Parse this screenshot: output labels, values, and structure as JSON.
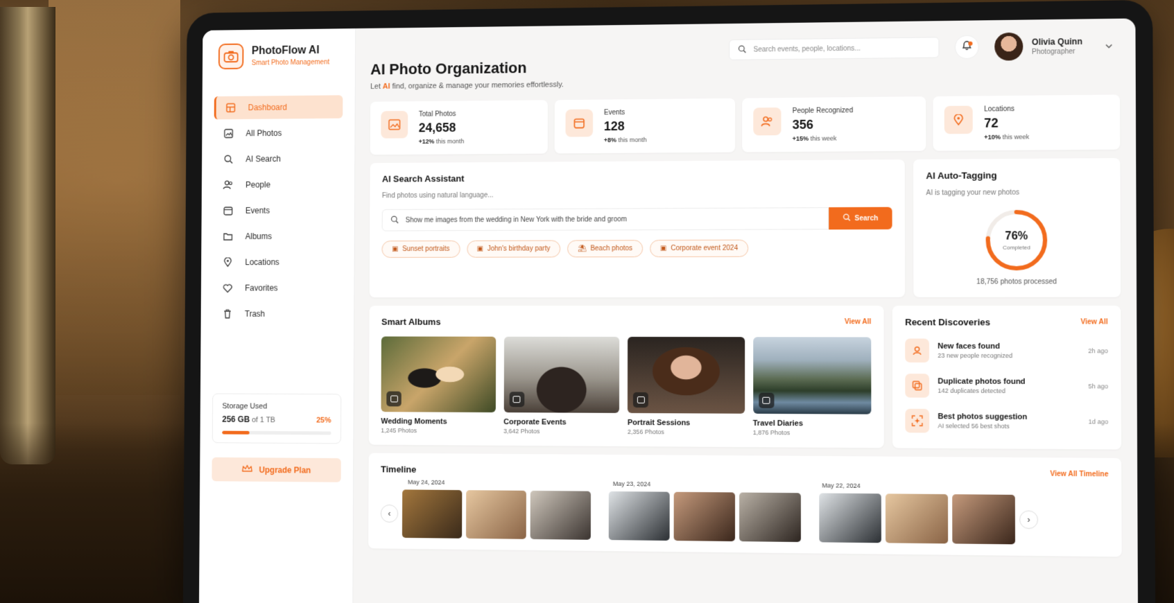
{
  "brand": {
    "name": "PhotoFlow AI",
    "tagline": "Smart Photo Management"
  },
  "sidebar": {
    "items": [
      {
        "label": "Dashboard",
        "icon": "dashboard-icon",
        "active": true
      },
      {
        "label": "All Photos",
        "icon": "photos-icon"
      },
      {
        "label": "AI Search",
        "icon": "search-icon"
      },
      {
        "label": "People",
        "icon": "people-icon"
      },
      {
        "label": "Events",
        "icon": "calendar-icon"
      },
      {
        "label": "Albums",
        "icon": "folder-icon"
      },
      {
        "label": "Locations",
        "icon": "location-pin-icon"
      },
      {
        "label": "Favorites",
        "icon": "heart-icon"
      },
      {
        "label": "Trash",
        "icon": "trash-icon"
      }
    ],
    "storage": {
      "title": "Storage Used",
      "used": "256 GB",
      "total": "of 1 TB",
      "percent_label": "25%",
      "percent": 25
    },
    "upgrade_label": "Upgrade Plan"
  },
  "topbar": {
    "search_placeholder": "Search events, people, locations...",
    "user": {
      "name": "Olivia Quinn",
      "role": "Photographer"
    }
  },
  "page": {
    "title": "AI Photo Organization",
    "subtitle_prefix": "Let ",
    "subtitle_highlight": "AI",
    "subtitle_suffix": " find, organize & manage your memories effortlessly."
  },
  "stats": [
    {
      "label": "Total Photos",
      "value": "24,658",
      "delta": "+12%",
      "delta_text": "this month",
      "icon": "image-icon"
    },
    {
      "label": "Events",
      "value": "128",
      "delta": "+8%",
      "delta_text": "this month",
      "icon": "calendar-icon"
    },
    {
      "label": "People Recognized",
      "value": "356",
      "delta": "+15%",
      "delta_text": "this week",
      "icon": "people-icon"
    },
    {
      "label": "Locations",
      "value": "72",
      "delta": "+10%",
      "delta_text": "this week",
      "icon": "location-pin-icon"
    }
  ],
  "assistant": {
    "title": "AI Search Assistant",
    "subtitle": "Find photos using natural language...",
    "query": "Show me images from the wedding in New York with the bride and groom",
    "button": "Search",
    "chips": [
      "Sunset portraits",
      "John's birthday party",
      "Beach photos",
      "Corporate event 2024"
    ]
  },
  "tagging": {
    "title": "AI Auto-Tagging",
    "subtitle": "AI is tagging your new photos",
    "percent_label": "76%",
    "percent": 76,
    "status": "Completed",
    "processed": "18,756 photos processed"
  },
  "albums": {
    "title": "Smart Albums",
    "view_all": "View All",
    "items": [
      {
        "name": "Wedding Moments",
        "count": "1,245 Photos"
      },
      {
        "name": "Corporate Events",
        "count": "3,642 Photos"
      },
      {
        "name": "Portrait Sessions",
        "count": "2,356 Photos"
      },
      {
        "name": "Travel Diaries",
        "count": "1,876 Photos"
      }
    ]
  },
  "discoveries": {
    "title": "Recent Discoveries",
    "view_all": "View All",
    "items": [
      {
        "title": "New faces found",
        "sub": "23 new people recognized",
        "time": "2h ago",
        "icon": "face-scan-icon"
      },
      {
        "title": "Duplicate photos found",
        "sub": "142 duplicates detected",
        "time": "5h ago",
        "icon": "duplicate-icon"
      },
      {
        "title": "Best photos suggestion",
        "sub": "AI selected 56 best shots",
        "time": "1d ago",
        "icon": "sparkle-scan-icon"
      }
    ]
  },
  "timeline": {
    "title": "Timeline",
    "view_all": "View All Timeline",
    "dates": [
      "May 24, 2024",
      "May 23, 2024",
      "May 22, 2024"
    ]
  },
  "colors": {
    "accent": "#f26b1d",
    "accent_soft": "#fde8da",
    "background": "#f6f5f4"
  }
}
